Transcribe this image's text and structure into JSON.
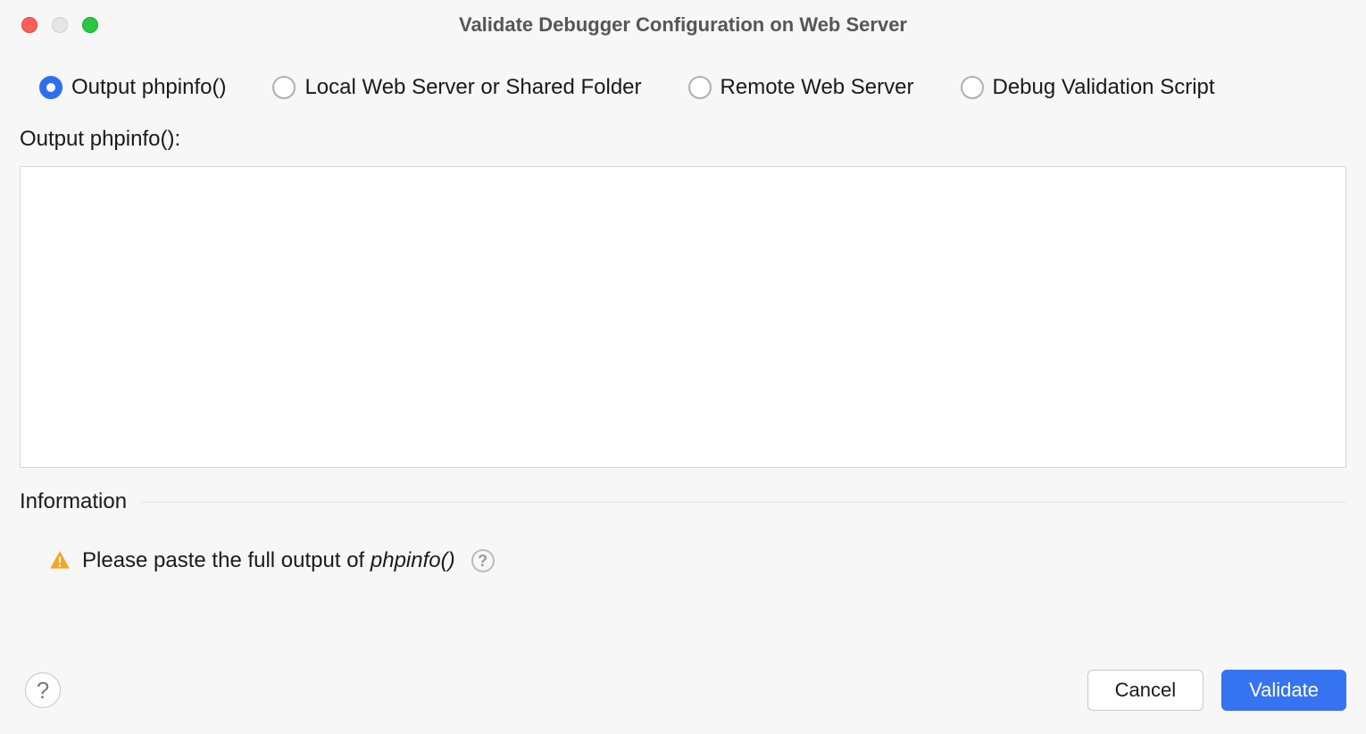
{
  "window": {
    "title": "Validate Debugger Configuration on Web Server"
  },
  "radios": {
    "option1": "Output phpinfo()",
    "option2": "Local Web Server or Shared Folder",
    "option3": "Remote Web Server",
    "option4": "Debug Validation Script",
    "selected": "option1"
  },
  "field": {
    "label": "Output phpinfo():",
    "value": ""
  },
  "information": {
    "section_title": "Information",
    "warn_text_prefix": "Please paste the full output of ",
    "warn_text_italic": "phpinfo()"
  },
  "footer": {
    "help_glyph": "?",
    "cancel": "Cancel",
    "validate": "Validate"
  }
}
